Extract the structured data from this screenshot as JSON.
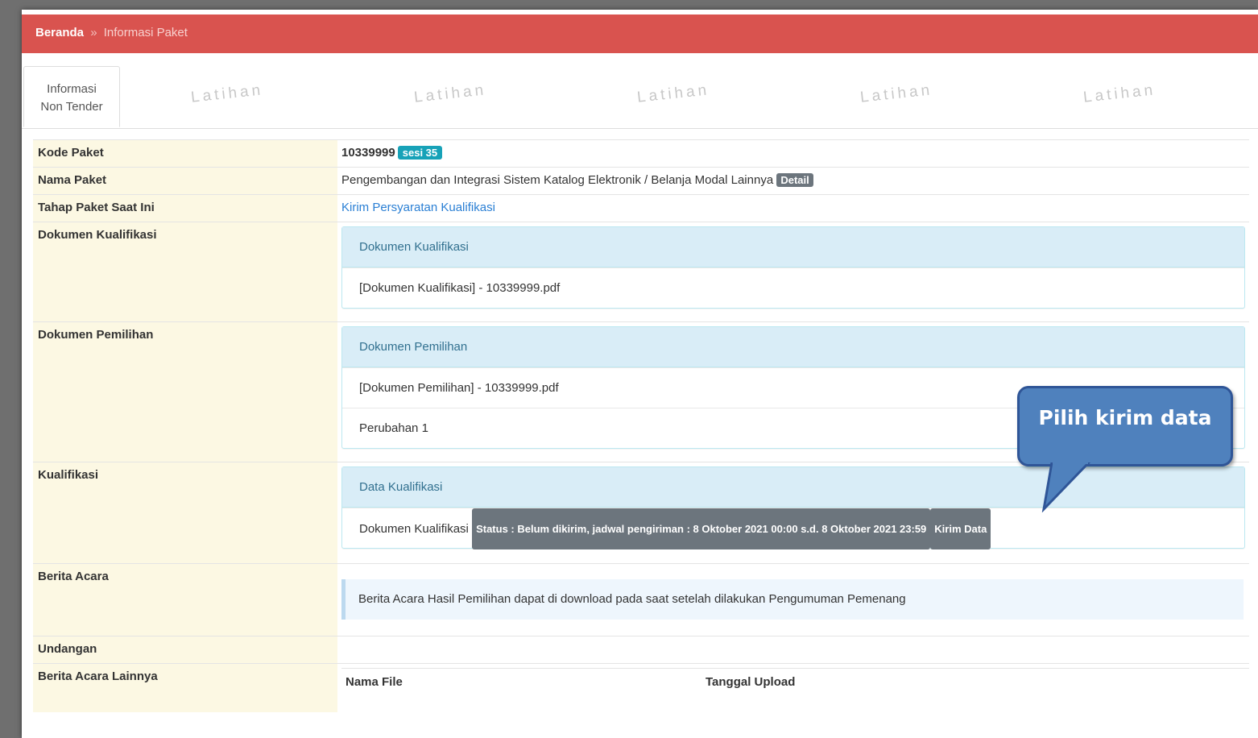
{
  "breadcrumb": {
    "home": "Beranda",
    "separator": "»",
    "current": "Informasi Paket"
  },
  "tab": {
    "line1": "Informasi",
    "line2": "Non Tender"
  },
  "watermark": "Latihan",
  "fields": {
    "kode_paket": {
      "label": "Kode Paket",
      "value": "10339999",
      "badge": "sesi 35"
    },
    "nama_paket": {
      "label": "Nama Paket",
      "value": "Pengembangan dan Integrasi Sistem Katalog Elektronik / Belanja Modal Lainnya",
      "badge": "Detail"
    },
    "tahap": {
      "label": "Tahap Paket Saat Ini",
      "value": "Kirim Persyaratan Kualifikasi"
    },
    "dok_kualifikasi": {
      "label": "Dokumen Kualifikasi",
      "panel_title": "Dokumen Kualifikasi",
      "items": [
        "[Dokumen Kualifikasi] - 10339999.pdf"
      ]
    },
    "dok_pemilihan": {
      "label": "Dokumen Pemilihan",
      "panel_title": "Dokumen Pemilihan",
      "items": [
        "[Dokumen Pemilihan] - 10339999.pdf",
        "Perubahan 1"
      ]
    },
    "kualifikasi": {
      "label": "Kualifikasi",
      "panel_title": "Data Kualifikasi",
      "item_label": "Dokumen Kualifikasi",
      "status": "Status : Belum dikirim, jadwal pengiriman : 8 Oktober 2021 00:00 s.d. 8 Oktober 2021 23:59",
      "action": "Kirim Data"
    },
    "berita_acara": {
      "label": "Berita Acara",
      "info": "Berita Acara Hasil Pemilihan dapat di download pada saat setelah dilakukan Pengumuman Pemenang"
    },
    "undangan": {
      "label": "Undangan"
    },
    "berita_lain": {
      "label": "Berita Acara Lainnya",
      "col_file": "Nama File",
      "col_date": "Tanggal Upload"
    }
  },
  "callout": {
    "text": "Pilih kirim data"
  },
  "colors": {
    "header": "#d9534f",
    "label_bg": "#fcf8e3",
    "panel_head": "#d9edf7",
    "badge_teal": "#17a2b8",
    "badge_gray": "#6c757d",
    "callout": "#4f81bd"
  }
}
